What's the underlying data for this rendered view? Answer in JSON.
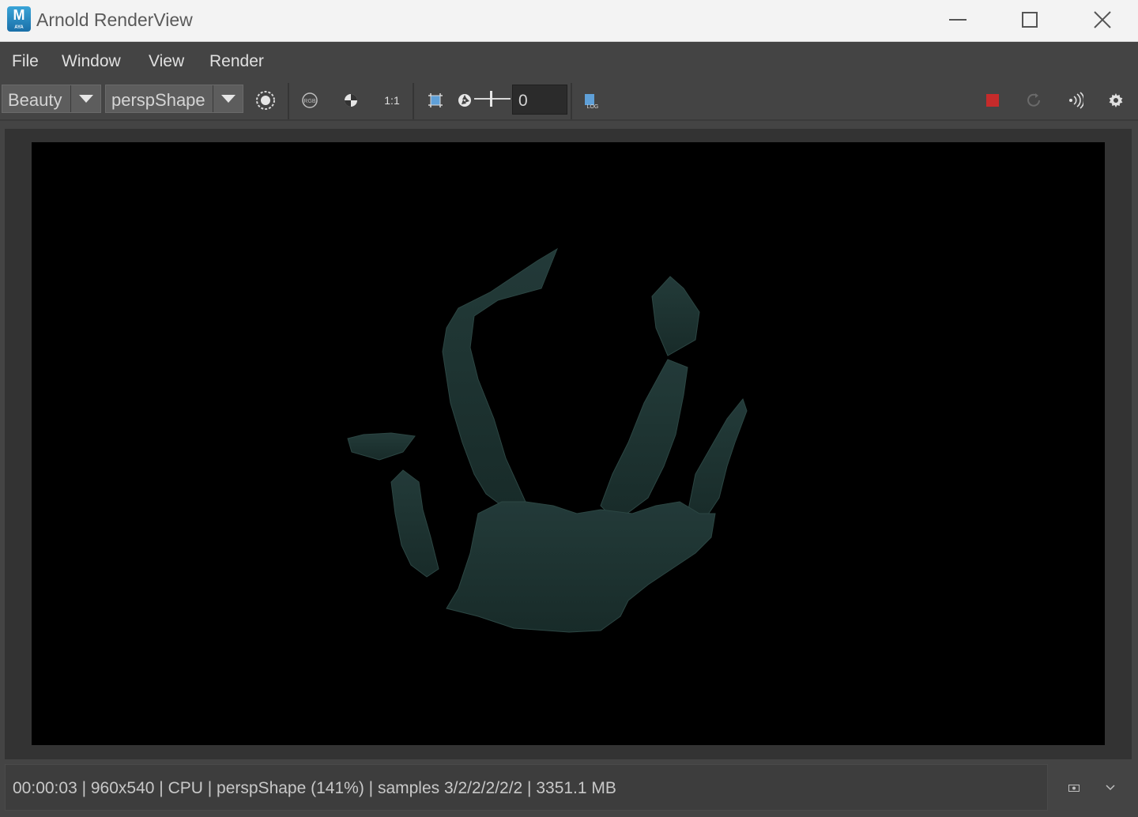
{
  "window": {
    "title": "Arnold RenderView",
    "app_icon_letter": "M",
    "app_icon_sub": "AYA"
  },
  "menu": [
    "File",
    "Window",
    "View",
    "Render"
  ],
  "toolbar": {
    "aov_select": "Beauty",
    "camera_select": "perspShape",
    "ratio_label": "1:1",
    "rgb_label": "RGB",
    "log_label": "LOG",
    "exposure_value": "0"
  },
  "status": {
    "text": "00:00:03 | 960x540 | CPU | perspShape (141%) | samples 3/2/2/2/2/2 | 3351.1 MB"
  },
  "colors": {
    "accent_stop": "#c62b2b",
    "render_bg": "#000000",
    "mesh": "#1f3533"
  },
  "icons": [
    "minimize-icon",
    "maximize-icon",
    "close-icon",
    "region-icon",
    "rgb-icon",
    "checker-icon",
    "crop-icon",
    "aperture-icon",
    "log-icon",
    "stop-icon",
    "refresh-icon",
    "ipr-icon",
    "gear-icon",
    "snapshot-icon",
    "chevron-down-icon"
  ]
}
